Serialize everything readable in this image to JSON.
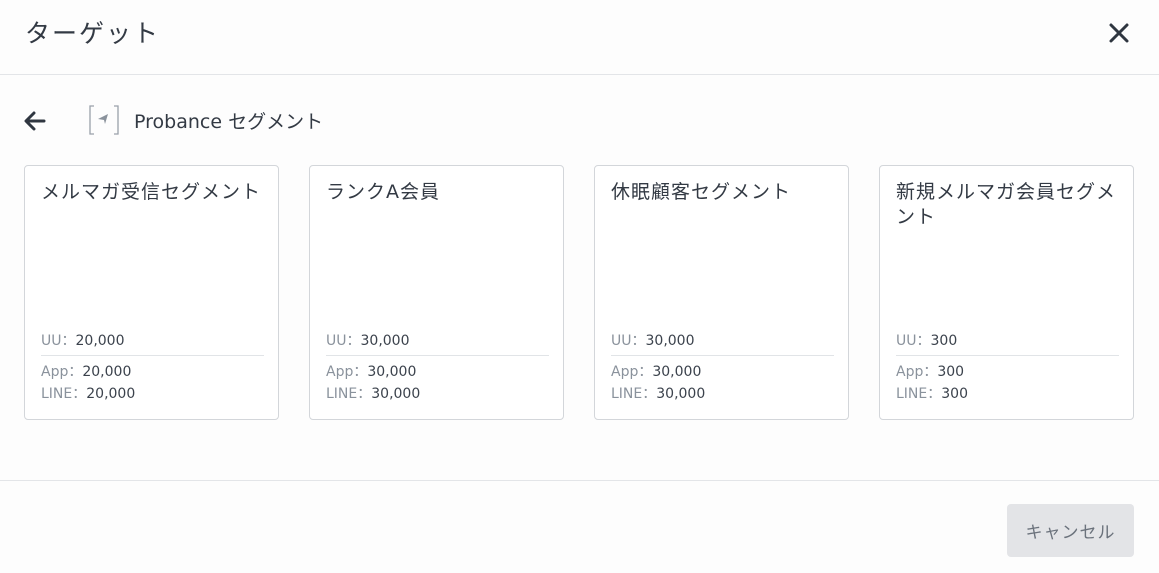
{
  "dialog": {
    "title": "ターゲット",
    "close_icon": "close-icon"
  },
  "breadcrumb": {
    "back_icon": "arrow-left-icon",
    "segment_icon": "segment-icon",
    "label": "Probance セグメント"
  },
  "cards": [
    {
      "name": "メルマガ受信セグメント",
      "uu_label": "UU：",
      "uu_value": "20,000",
      "app_label": "App：",
      "app_value": "20,000",
      "line_label": "LINE：",
      "line_value": "20,000"
    },
    {
      "name": "ランクA会員",
      "uu_label": "UU：",
      "uu_value": "30,000",
      "app_label": "App：",
      "app_value": "30,000",
      "line_label": "LINE：",
      "line_value": "30,000"
    },
    {
      "name": "休眠顧客セグメント",
      "uu_label": "UU：",
      "uu_value": "30,000",
      "app_label": "App：",
      "app_value": "30,000",
      "line_label": "LINE：",
      "line_value": "30,000"
    },
    {
      "name": "新規メルマガ会員セグメント",
      "uu_label": "UU：",
      "uu_value": "300",
      "app_label": "App：",
      "app_value": "300",
      "line_label": "LINE：",
      "line_value": "300"
    }
  ],
  "footer": {
    "cancel_label": "キャンセル"
  },
  "colors": {
    "text": "#333a44",
    "muted": "#8a929c",
    "border": "#d3d6da",
    "cancel_bg": "#e3e4e7"
  }
}
